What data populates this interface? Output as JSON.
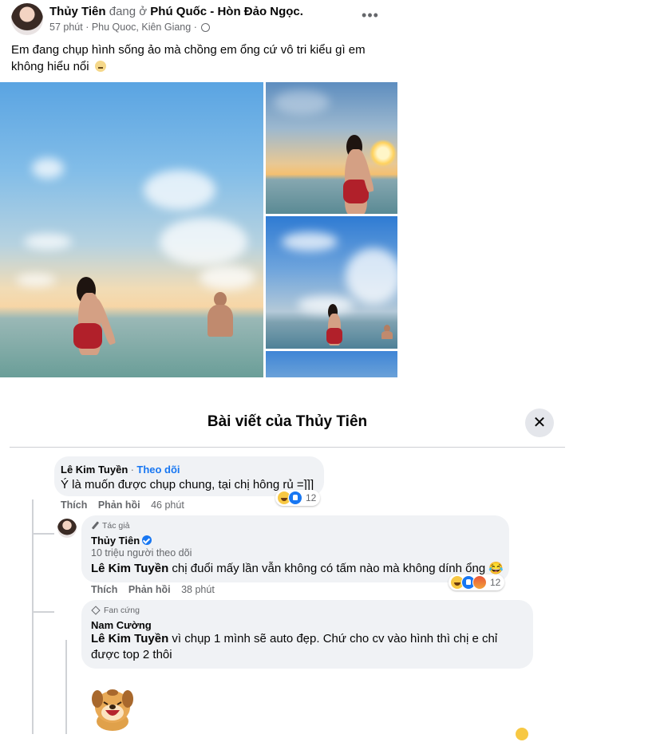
{
  "post": {
    "author": "Thủy Tiên",
    "at_text": "đang ở",
    "location": "Phú Quốc - Hòn Đảo Ngọc.",
    "time": "57 phút",
    "place": "Phu Quoc, Kiên Giang",
    "caption": "Em đang chụp hình sống ảo mà chồng em ổng cứ vô tri kiểu gì em không hiểu nổi",
    "more_icon": "more-horizontal-icon"
  },
  "dialog": {
    "title": "Bài viết của Thủy Tiên",
    "close_symbol": "✕"
  },
  "comments": [
    {
      "name": "Lê Kim Tuyền",
      "separator": " · ",
      "follow": "Theo dõi",
      "text": "Ý là muốn được chụp chung, tại chị hông rủ =]]]",
      "like_label": "Thích",
      "reply_label": "Phản hồi",
      "time": "46 phút",
      "reaction_count": "12"
    },
    {
      "badge": "Tác giả",
      "name": "Thủy Tiên",
      "followers": "10 triệu người theo dõi",
      "mention": "Lê Kim Tuyền",
      "text": " chị đuổi mấy lần vẫn không có tấm nào mà không dính ổng 😂",
      "like_label": "Thích",
      "reply_label": "Phản hồi",
      "time": "38 phút",
      "reaction_count": "12"
    },
    {
      "badge": "Fan cứng",
      "name": "Nam Cường",
      "mention": "Lê Kim Tuyền",
      "text": " vì chụp 1 mình sẽ auto đẹp. Chứ cho cv vào hình thì chị e chỉ được top 2 thôi"
    }
  ]
}
